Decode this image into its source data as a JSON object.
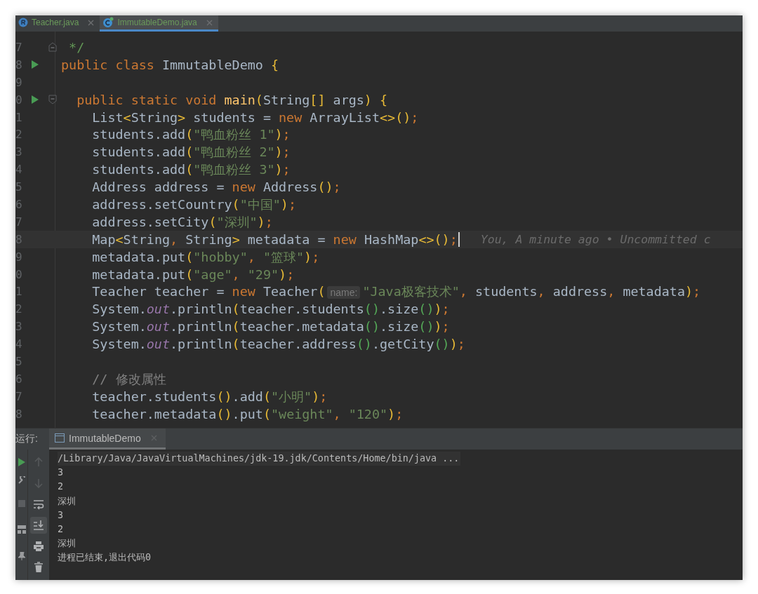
{
  "editor_tabs": [
    {
      "label": "Teacher.java",
      "kind": "record",
      "selected": false
    },
    {
      "label": "ImmutableDemo.java",
      "kind": "class",
      "selected": true
    }
  ],
  "editor": {
    "lines": [
      {
        "number": "7",
        "kind": "fold-end",
        "run": false,
        "current": false,
        "tokens": [
          {
            "kind": "doc",
            "text": " */"
          }
        ]
      },
      {
        "number": "8",
        "run": true,
        "current": false,
        "tokens": [
          {
            "kind": "keyword",
            "text": "public class "
          },
          {
            "kind": "plain",
            "text": "ImmutableDemo "
          },
          {
            "kind": "bracket",
            "text": "{"
          }
        ]
      },
      {
        "number": "9",
        "run": false,
        "current": false
      },
      {
        "number": "0",
        "kind": "fold-start",
        "run": true,
        "current": false,
        "tokens": [
          {
            "kind": "keyword",
            "text": "  public static void "
          },
          {
            "kind": "method",
            "text": "main"
          },
          {
            "kind": "bracket",
            "text": "("
          },
          {
            "kind": "plain",
            "text": "String"
          },
          {
            "kind": "bracket",
            "text": "[]"
          },
          {
            "kind": "plain",
            "text": " args"
          },
          {
            "kind": "bracket",
            "text": ")"
          },
          {
            "kind": "bracket",
            "text": " {"
          }
        ]
      },
      {
        "number": "1",
        "run": false,
        "current": false,
        "tokens": [
          {
            "kind": "plain",
            "text": "    List"
          },
          {
            "kind": "bracket",
            "text": "<"
          },
          {
            "kind": "plain",
            "text": "String"
          },
          {
            "kind": "bracket",
            "text": ">"
          },
          {
            "kind": "plain",
            "text": " students = "
          },
          {
            "kind": "keyword",
            "text": "new "
          },
          {
            "kind": "plain",
            "text": "ArrayList"
          },
          {
            "kind": "bracket",
            "text": "<>()"
          },
          {
            "kind": "punct",
            "text": ";"
          }
        ]
      },
      {
        "number": "2",
        "run": false,
        "current": false,
        "tokens": [
          {
            "kind": "plain",
            "text": "    students.add"
          },
          {
            "kind": "bracket",
            "text": "("
          },
          {
            "kind": "string",
            "text": "\"鸭血粉丝 1\""
          },
          {
            "kind": "bracket",
            "text": ")"
          },
          {
            "kind": "punct",
            "text": ";"
          }
        ]
      },
      {
        "number": "3",
        "run": false,
        "current": false,
        "tokens": [
          {
            "kind": "plain",
            "text": "    students.add"
          },
          {
            "kind": "bracket",
            "text": "("
          },
          {
            "kind": "string",
            "text": "\"鸭血粉丝 2\""
          },
          {
            "kind": "bracket",
            "text": ")"
          },
          {
            "kind": "punct",
            "text": ";"
          }
        ]
      },
      {
        "number": "4",
        "run": false,
        "current": false,
        "tokens": [
          {
            "kind": "plain",
            "text": "    students.add"
          },
          {
            "kind": "bracket",
            "text": "("
          },
          {
            "kind": "string",
            "text": "\"鸭血粉丝 3\""
          },
          {
            "kind": "bracket",
            "text": ")"
          },
          {
            "kind": "punct",
            "text": ";"
          }
        ]
      },
      {
        "number": "5",
        "run": false,
        "current": false,
        "tokens": [
          {
            "kind": "plain",
            "text": "    Address address = "
          },
          {
            "kind": "keyword",
            "text": "new "
          },
          {
            "kind": "plain",
            "text": "Address"
          },
          {
            "kind": "bracket",
            "text": "()"
          },
          {
            "kind": "punct",
            "text": ";"
          }
        ]
      },
      {
        "number": "6",
        "run": false,
        "current": false,
        "tokens": [
          {
            "kind": "plain",
            "text": "    address.setCountry"
          },
          {
            "kind": "bracket",
            "text": "("
          },
          {
            "kind": "string",
            "text": "\"中国\""
          },
          {
            "kind": "bracket",
            "text": ")"
          },
          {
            "kind": "punct",
            "text": ";"
          }
        ]
      },
      {
        "number": "7",
        "run": false,
        "current": false,
        "tokens": [
          {
            "kind": "plain",
            "text": "    address.setCity"
          },
          {
            "kind": "bracket",
            "text": "("
          },
          {
            "kind": "string",
            "text": "\"深圳\""
          },
          {
            "kind": "bracket",
            "text": ")"
          },
          {
            "kind": "punct",
            "text": ";"
          }
        ]
      },
      {
        "number": "8",
        "run": false,
        "current": true,
        "annotation": "You, A minute ago • Uncommitted c",
        "tokens": [
          {
            "kind": "plain",
            "text": "    Map"
          },
          {
            "kind": "bracket",
            "text": "<"
          },
          {
            "kind": "plain",
            "text": "String"
          },
          {
            "kind": "punct",
            "text": ", "
          },
          {
            "kind": "plain",
            "text": "String"
          },
          {
            "kind": "bracket",
            "text": ">"
          },
          {
            "kind": "plain",
            "text": " metadata = "
          },
          {
            "kind": "keyword",
            "text": "new "
          },
          {
            "kind": "plain",
            "text": "HashMap"
          },
          {
            "kind": "bracket",
            "text": "<>()"
          },
          {
            "kind": "punct",
            "text": ";"
          }
        ]
      },
      {
        "number": "9",
        "run": false,
        "current": false,
        "tokens": [
          {
            "kind": "plain",
            "text": "    metadata.put"
          },
          {
            "kind": "bracket",
            "text": "("
          },
          {
            "kind": "string",
            "text": "\"hobby\""
          },
          {
            "kind": "punct",
            "text": ", "
          },
          {
            "kind": "string",
            "text": "\"篮球\""
          },
          {
            "kind": "bracket",
            "text": ")"
          },
          {
            "kind": "punct",
            "text": ";"
          }
        ]
      },
      {
        "number": "0",
        "run": false,
        "current": false,
        "tokens": [
          {
            "kind": "plain",
            "text": "    metadata.put"
          },
          {
            "kind": "bracket",
            "text": "("
          },
          {
            "kind": "string",
            "text": "\"age\""
          },
          {
            "kind": "punct",
            "text": ", "
          },
          {
            "kind": "string",
            "text": "\"29\""
          },
          {
            "kind": "bracket",
            "text": ")"
          },
          {
            "kind": "punct",
            "text": ";"
          }
        ]
      },
      {
        "number": "1",
        "run": false,
        "current": false,
        "tokens": [
          {
            "kind": "plain",
            "text": "    Teacher teacher = "
          },
          {
            "kind": "keyword",
            "text": "new "
          },
          {
            "kind": "plain",
            "text": "Teacher"
          },
          {
            "kind": "bracket",
            "text": "("
          },
          {
            "kind": "hint",
            "text": "name:"
          },
          {
            "kind": "string",
            "text": "\"Java极客技术\""
          },
          {
            "kind": "punct",
            "text": ", "
          },
          {
            "kind": "plain",
            "text": "students"
          },
          {
            "kind": "punct",
            "text": ", "
          },
          {
            "kind": "plain",
            "text": "address"
          },
          {
            "kind": "punct",
            "text": ", "
          },
          {
            "kind": "plain",
            "text": "metadata"
          },
          {
            "kind": "bracket",
            "text": ")"
          },
          {
            "kind": "punct",
            "text": ";"
          }
        ]
      },
      {
        "number": "2",
        "run": false,
        "current": false,
        "tokens": [
          {
            "kind": "plain",
            "text": "    System."
          },
          {
            "kind": "static",
            "text": "out"
          },
          {
            "kind": "plain",
            "text": ".println"
          },
          {
            "kind": "bracket",
            "text": "("
          },
          {
            "kind": "plain",
            "text": "teacher.students"
          },
          {
            "kind": "bracket2",
            "text": "()"
          },
          {
            "kind": "plain",
            "text": ".size"
          },
          {
            "kind": "bracket2",
            "text": "()"
          },
          {
            "kind": "bracket",
            "text": ")"
          },
          {
            "kind": "punct",
            "text": ";"
          }
        ]
      },
      {
        "number": "3",
        "run": false,
        "current": false,
        "tokens": [
          {
            "kind": "plain",
            "text": "    System."
          },
          {
            "kind": "static",
            "text": "out"
          },
          {
            "kind": "plain",
            "text": ".println"
          },
          {
            "kind": "bracket",
            "text": "("
          },
          {
            "kind": "plain",
            "text": "teacher.metadata"
          },
          {
            "kind": "bracket2",
            "text": "()"
          },
          {
            "kind": "plain",
            "text": ".size"
          },
          {
            "kind": "bracket2",
            "text": "()"
          },
          {
            "kind": "bracket",
            "text": ")"
          },
          {
            "kind": "punct",
            "text": ";"
          }
        ]
      },
      {
        "number": "4",
        "run": false,
        "current": false,
        "tokens": [
          {
            "kind": "plain",
            "text": "    System."
          },
          {
            "kind": "static",
            "text": "out"
          },
          {
            "kind": "plain",
            "text": ".println"
          },
          {
            "kind": "bracket",
            "text": "("
          },
          {
            "kind": "plain",
            "text": "teacher.address"
          },
          {
            "kind": "bracket2",
            "text": "()"
          },
          {
            "kind": "plain",
            "text": ".getCity"
          },
          {
            "kind": "bracket2",
            "text": "()"
          },
          {
            "kind": "bracket",
            "text": ")"
          },
          {
            "kind": "punct",
            "text": ";"
          }
        ]
      },
      {
        "number": "5",
        "run": false,
        "current": false
      },
      {
        "number": "6",
        "run": false,
        "current": false,
        "tokens": [
          {
            "kind": "comment",
            "text": "    // 修改属性"
          }
        ]
      },
      {
        "number": "7",
        "run": false,
        "current": false,
        "tokens": [
          {
            "kind": "plain",
            "text": "    teacher.students"
          },
          {
            "kind": "bracket",
            "text": "()"
          },
          {
            "kind": "plain",
            "text": ".add"
          },
          {
            "kind": "bracket",
            "text": "("
          },
          {
            "kind": "string",
            "text": "\"小明\""
          },
          {
            "kind": "bracket",
            "text": ")"
          },
          {
            "kind": "punct",
            "text": ";"
          }
        ]
      },
      {
        "number": "8",
        "run": false,
        "current": false,
        "tokens": [
          {
            "kind": "plain",
            "text": "    teacher.metadata"
          },
          {
            "kind": "bracket",
            "text": "()"
          },
          {
            "kind": "plain",
            "text": ".put"
          },
          {
            "kind": "bracket",
            "text": "("
          },
          {
            "kind": "string",
            "text": "\"weight\""
          },
          {
            "kind": "punct",
            "text": ", "
          },
          {
            "kind": "string",
            "text": "\"120\""
          },
          {
            "kind": "bracket",
            "text": ")"
          },
          {
            "kind": "punct",
            "text": ";"
          }
        ]
      }
    ]
  },
  "run_panel": {
    "label": "运行:",
    "tabs": [
      {
        "label": "ImmutableDemo",
        "selected": true
      }
    ],
    "tools": [
      {
        "kind": "up",
        "disabled": true,
        "selected": false
      },
      {
        "kind": "down",
        "disabled": true,
        "selected": false
      },
      {
        "kind": "wrap",
        "disabled": false,
        "selected": false
      },
      {
        "kind": "scroll-end",
        "disabled": false,
        "selected": true
      },
      {
        "kind": "print",
        "disabled": false,
        "selected": false
      },
      {
        "kind": "trash",
        "disabled": false,
        "selected": false
      }
    ],
    "output": [
      {
        "kind": "command",
        "text": "/Library/Java/JavaVirtualMachines/jdk-19.jdk/Contents/Home/bin/java ..."
      },
      {
        "kind": "stdout",
        "text": "3"
      },
      {
        "kind": "stdout",
        "text": "2"
      },
      {
        "kind": "stdout",
        "text": "深圳"
      },
      {
        "kind": "stdout",
        "text": "3"
      },
      {
        "kind": "stdout",
        "text": "2"
      },
      {
        "kind": "stdout",
        "text": "深圳"
      },
      {
        "kind": "exit",
        "text": "进程已结束,退出代码0"
      }
    ]
  }
}
